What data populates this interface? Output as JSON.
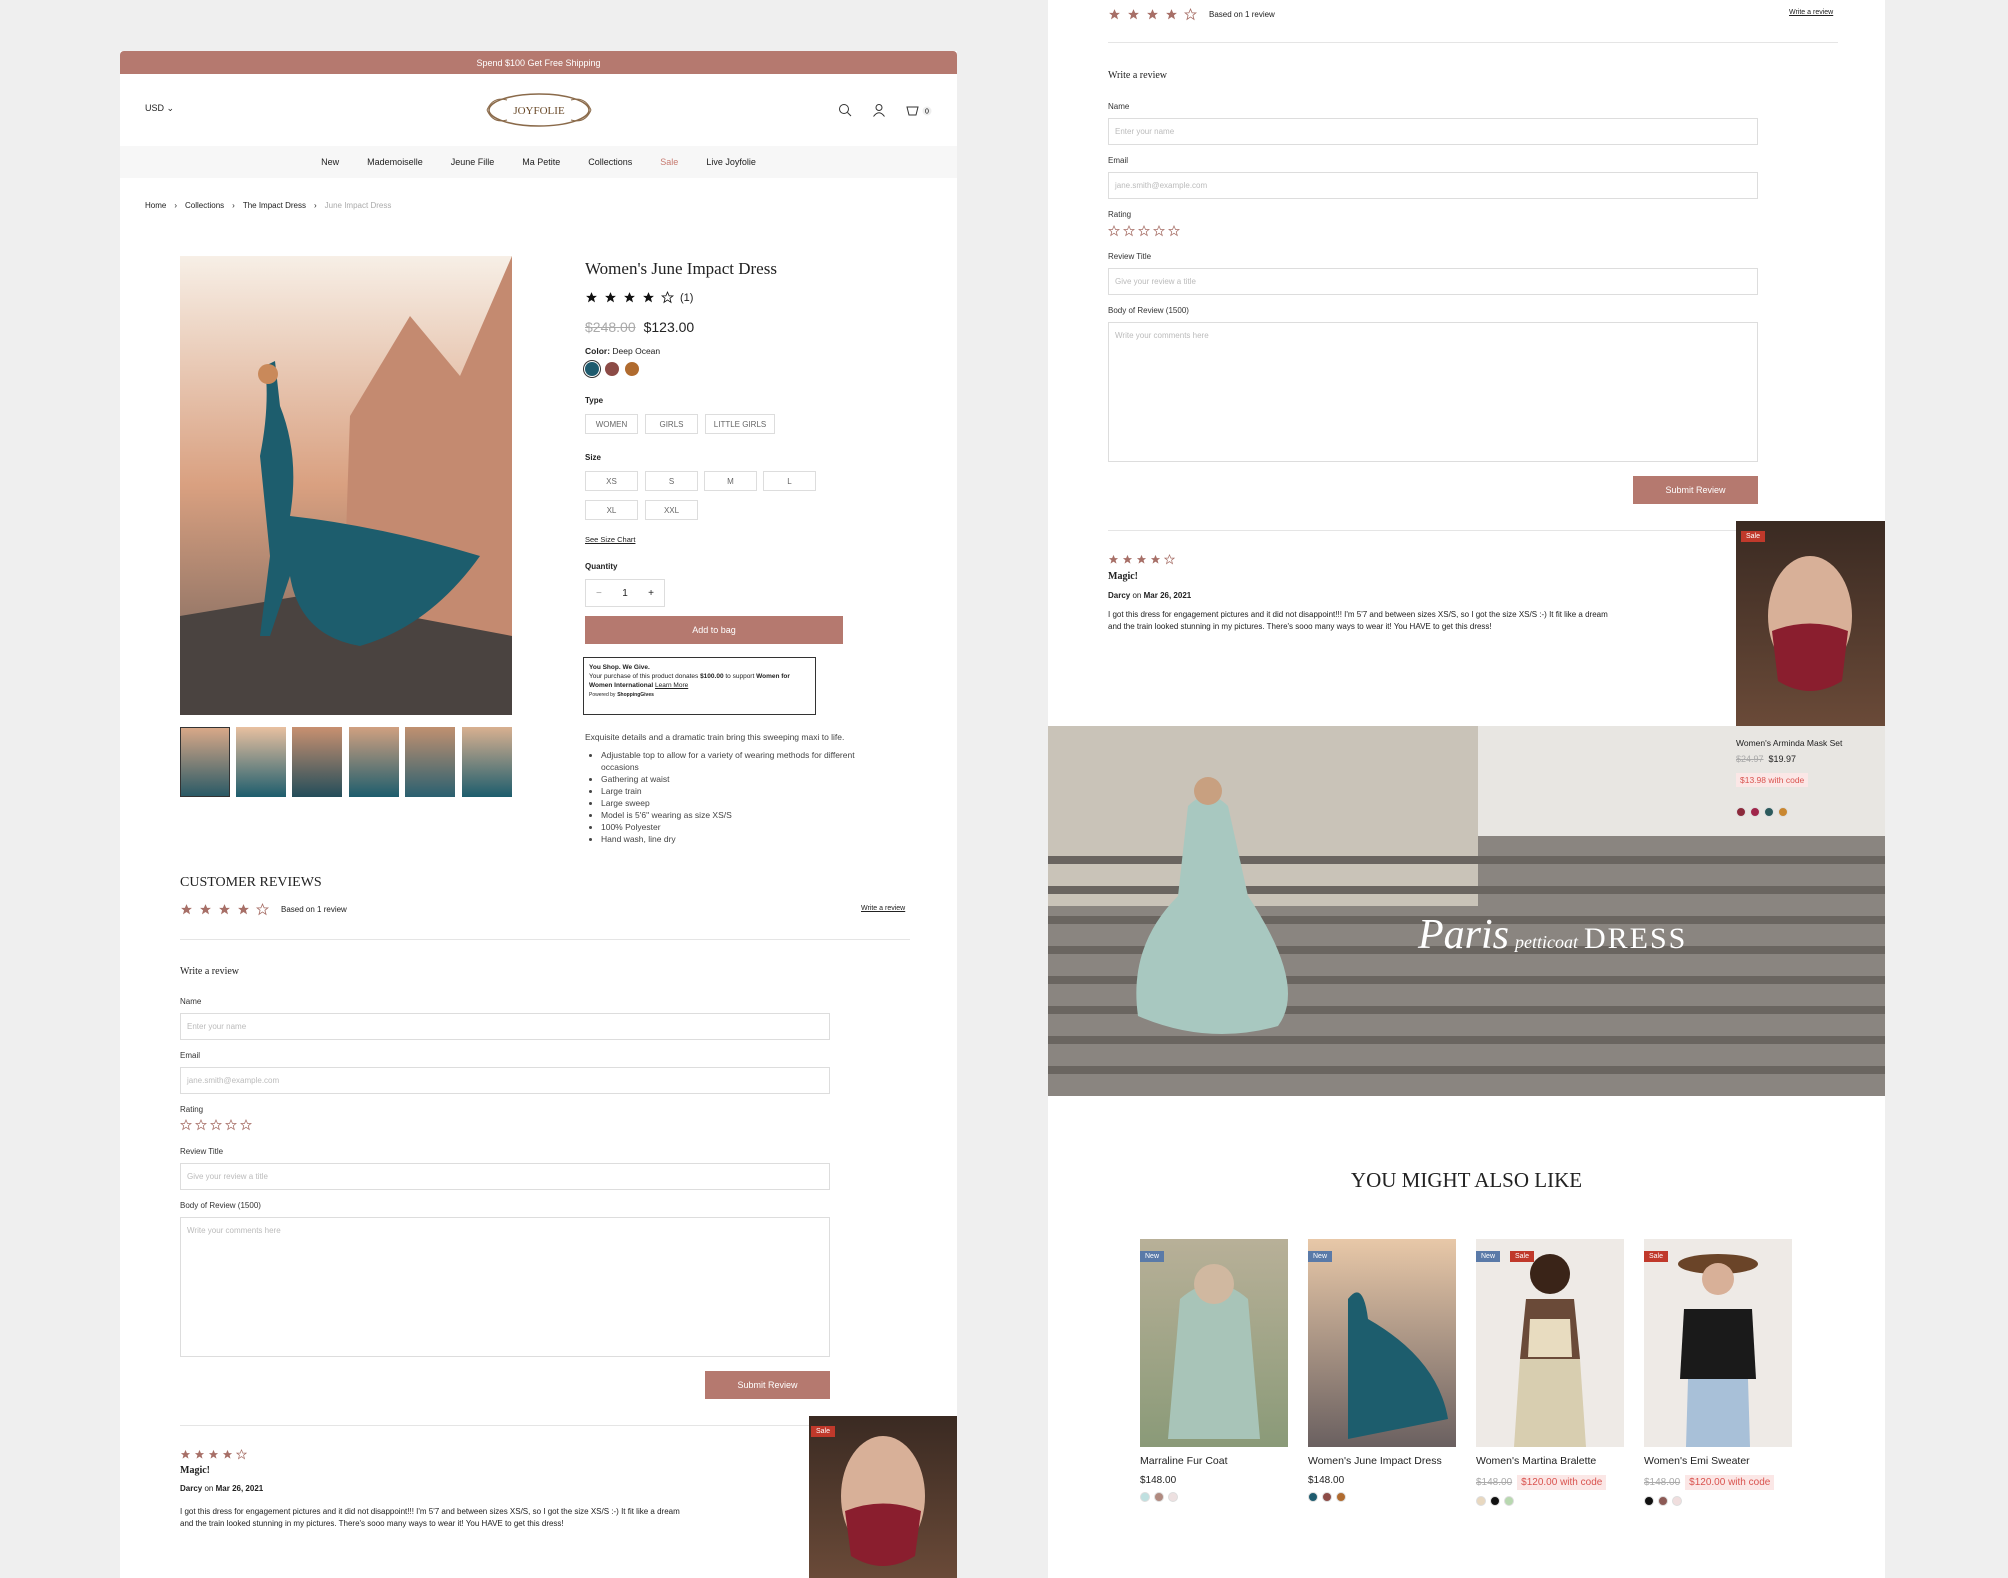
{
  "promo": "Spend $100 Get Free Shipping",
  "header": {
    "currency": "USD",
    "logo_text": "JOYFOLIE",
    "cart_count": "0"
  },
  "nav": [
    "New",
    "Mademoiselle",
    "Jeune Fille",
    "Ma Petite",
    "Collections",
    "Sale",
    "Live Joyfolie"
  ],
  "breadcrumb": [
    "Home",
    "Collections",
    "The Impact Dress",
    "June Impact Dress"
  ],
  "product": {
    "title": "Women's June Impact Dress",
    "rating": 4,
    "review_count": "(1)",
    "old_price": "$248.00",
    "price": "$123.00",
    "color_label": "Color:",
    "color_value": "Deep Ocean",
    "colors": [
      "#1e5b6e",
      "#8c4b46",
      "#b06b2f"
    ],
    "type_label": "Type",
    "types": [
      "WOMEN",
      "GIRLS",
      "LITTLE GIRLS"
    ],
    "size_label": "Size",
    "sizes": [
      "XS",
      "S",
      "M",
      "L",
      "XL",
      "XXL"
    ],
    "size_chart": "See Size Chart",
    "qty_label": "Quantity",
    "qty": "1",
    "add_to_bag": "Add to bag",
    "give": {
      "title": "You Shop. We Give.",
      "text1": "Your purchase of this product donates",
      "amount": "$100.00",
      "text2": "to support",
      "org": "Women for Women International",
      "learn": "Learn More",
      "powered": "Powered by",
      "brand": "ShoppingGives"
    },
    "description": "Exquisite details and a dramatic train bring this sweeping maxi to life.",
    "bullets": [
      "Adjustable top to allow for a variety of wearing methods for different occasions",
      "Gathering at waist",
      "Large train",
      "Large sweep",
      "Model is 5'6\" wearing as size XS/S",
      "100% Polyester",
      "Hand wash, line dry"
    ]
  },
  "reviews": {
    "heading": "CUSTOMER REVIEWS",
    "based_on": "Based on 1 review",
    "write_link": "Write a review",
    "form_title": "Write a review",
    "name_label": "Name",
    "name_ph": "Enter your name",
    "email_label": "Email",
    "email_ph": "jane.smith@example.com",
    "rating_label": "Rating",
    "title_label": "Review Title",
    "title_ph": "Give your review a title",
    "body_label": "Body of Review (1500)",
    "body_ph": "Write your comments here",
    "submit": "Submit Review",
    "item": {
      "title": "Magic!",
      "author": "Darcy",
      "on": "on",
      "date": "Mar 26, 2021",
      "text": "I got this dress for engagement pictures and it did not disappoint!!! I'm 5'7 and between sizes XS/S, so I got the size XS/S :-) It fit like a dream and the train looked stunning in my pictures. There's sooo many ways to wear it! You HAVE to get this dress!"
    }
  },
  "popup": {
    "badge": "Sale",
    "name": "Women's Arminda Mask Set",
    "old": "$24.97",
    "price": "$19.97",
    "code": "$13.98 with code",
    "colors": [
      "#8c2a3b",
      "#a0264a",
      "#2c5a5c",
      "#c98730"
    ]
  },
  "banner": {
    "script": "Paris",
    "small": "petticoat",
    "big": "DRESS"
  },
  "also": {
    "heading": "YOU MIGHT ALSO LIKE",
    "items": [
      {
        "badges": [
          "New"
        ],
        "name": "Marraline Fur Coat",
        "price": "$148.00",
        "old": "",
        "code": "",
        "colors": [
          "#bfe0e0",
          "#b08a80",
          "#ede0e0"
        ]
      },
      {
        "badges": [
          "New"
        ],
        "name": "Women's June Impact Dress",
        "price": "$148.00",
        "old": "",
        "code": "",
        "colors": [
          "#1e5b6e",
          "#8c4b46",
          "#b06b2f"
        ]
      },
      {
        "badges": [
          "New",
          "Sale"
        ],
        "name": "Women's Martina Bralette",
        "price": "",
        "old": "$148.00",
        "code": "$120.00 with code",
        "colors": [
          "#e8d8c0",
          "#111111",
          "#b8d8b0"
        ]
      },
      {
        "badges": [
          "Sale"
        ],
        "name": "Women's Emi Sweater",
        "price": "",
        "old": "$148.00",
        "code": "$120.00 with code",
        "colors": [
          "#111111",
          "#8c5a55",
          "#f0dede"
        ]
      }
    ]
  }
}
